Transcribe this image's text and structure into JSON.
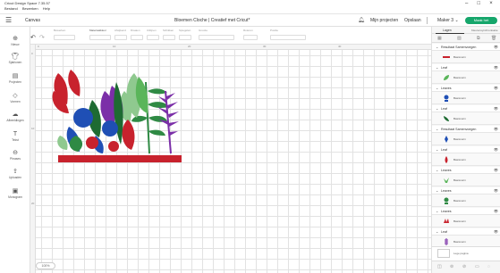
{
  "window": {
    "app_title": "Cricut Design Space 7.35.57",
    "menu": [
      "Bestand",
      "Bewerken",
      "Help"
    ],
    "controls": [
      "–",
      "□",
      "×"
    ]
  },
  "header": {
    "canvas_label": "Canvas",
    "project_title": "Bloemen Cloche | Creatief met Cricut*",
    "my_projects": "Mijn projecten",
    "save": "Opslaan",
    "machine": "Maker 3",
    "make_it": "Maak het"
  },
  "left_toolbar": [
    {
      "icon": "new-icon",
      "label": "Nieuw"
    },
    {
      "icon": "templates-icon",
      "label": "Sjablonen"
    },
    {
      "icon": "projects-icon",
      "label": "Projecten"
    },
    {
      "icon": "shapes-icon",
      "label": "Vormen"
    },
    {
      "icon": "images-icon",
      "label": "Afbeeldingen"
    },
    {
      "icon": "text-icon",
      "label": "Tekst"
    },
    {
      "icon": "phrases-icon",
      "label": "Phrases"
    },
    {
      "icon": "upload-icon",
      "label": "Uploaden"
    },
    {
      "icon": "monogram-icon",
      "label": "Monogram"
    }
  ],
  "edit_toolbar": {
    "controls": [
      "Bewerken",
      "Materiaalkleur",
      "Afwijkend",
      "Draaien",
      "Uitlijnen",
      "Schikken",
      "Spiegelen",
      "Grootte",
      "Roteren",
      "Positie"
    ],
    "selected": "Bewerken"
  },
  "rulers": {
    "top": [
      "0",
      "10",
      "20",
      "30",
      "40"
    ],
    "left": [
      "0",
      "10",
      "20"
    ]
  },
  "zoom_level": "100%",
  "panel": {
    "tabs": [
      "Lagen",
      "Kleurensynchronisatie"
    ],
    "active_tab": "Lagen",
    "layers": [
      {
        "type": "group",
        "name": "Resultaat Samenvoegen",
        "operation": "Basisvorm",
        "color": "#c8222d"
      },
      {
        "type": "group",
        "name": "Leaf",
        "operation": "Basisvorm",
        "color": "#5ab55a"
      },
      {
        "type": "group",
        "name": "Leaves",
        "operation": "Basisvorm",
        "color": "#1f4fb5"
      },
      {
        "type": "group",
        "name": "Leaf",
        "operation": "Basisvorm",
        "color": "#1e6b32"
      },
      {
        "type": "group",
        "name": "Resultaat Samenvoegen",
        "operation": "Basisvorm",
        "color": "#1f4fb5"
      },
      {
        "type": "group",
        "name": "Leaf",
        "operation": "Basisvorm",
        "color": "#c8222d"
      },
      {
        "type": "group",
        "name": "Leaves",
        "operation": "Basisvorm",
        "color": "#5ab55a"
      },
      {
        "type": "group",
        "name": "Leaves",
        "operation": "Basisvorm",
        "color": "#2f8a44"
      },
      {
        "type": "group",
        "name": "Leaves",
        "operation": "Basisvorm",
        "color": "#c8222d"
      },
      {
        "type": "group",
        "name": "Leaf",
        "operation": "Basisvorm",
        "color": "#7b2fa8"
      }
    ],
    "blank_label": "Lege pagina"
  },
  "colors": {
    "brand_green": "#16a66b",
    "red": "#c8222d",
    "blue": "#1f4fb5",
    "purple": "#7b2fa8",
    "light_green": "#8fc98f",
    "dark_green": "#1e6b32"
  }
}
